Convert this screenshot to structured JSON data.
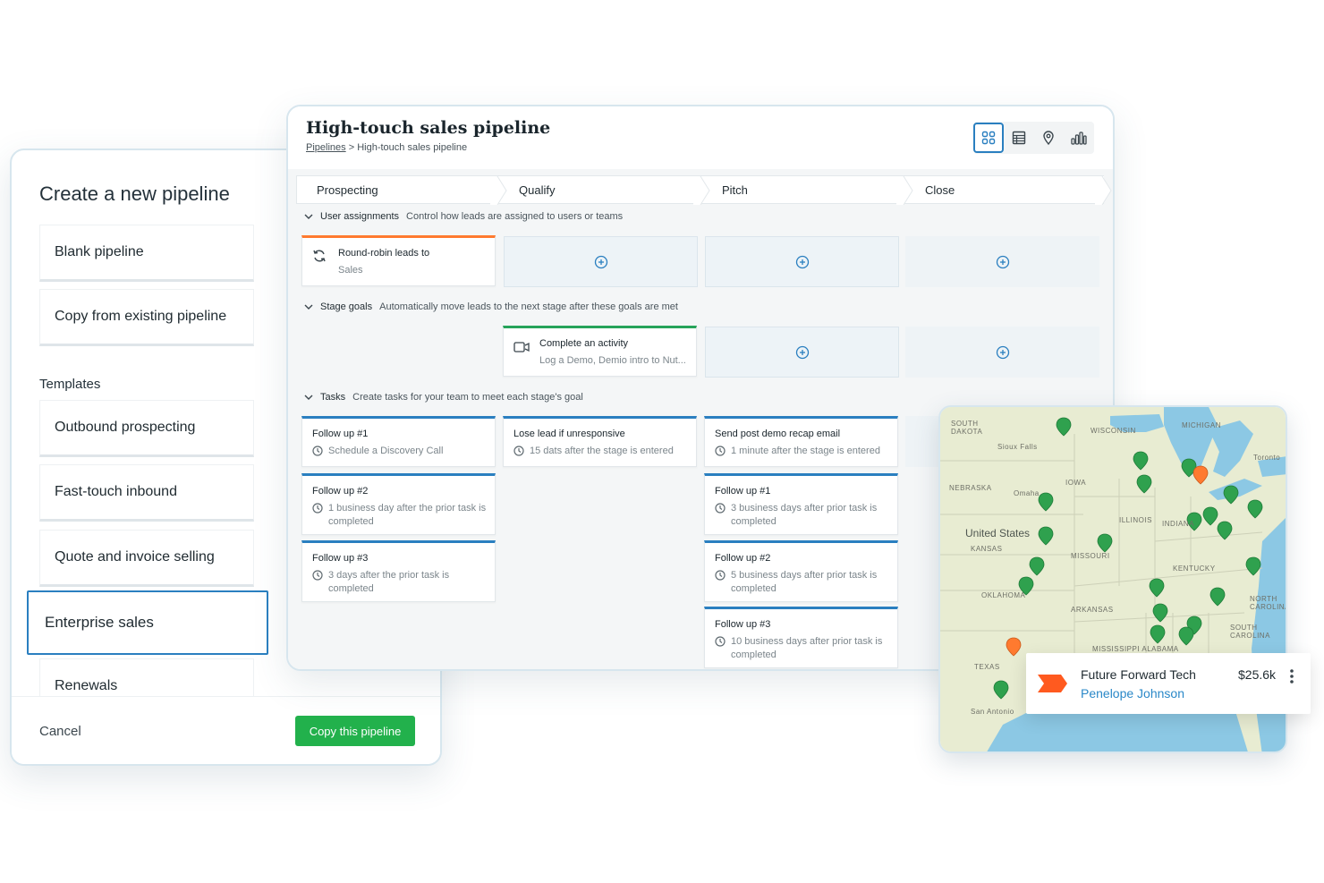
{
  "create_panel": {
    "title": "Create a new pipeline",
    "blank": "Blank pipeline",
    "copy_existing": "Copy from existing pipeline",
    "templates_label": "Templates",
    "templates": [
      "Outbound prospecting",
      "Fast-touch inbound",
      "Quote and invoice selling",
      "Enterprise sales",
      "Renewals"
    ],
    "cancel": "Cancel",
    "copy_button": "Copy this pipeline"
  },
  "pipeline": {
    "title": "High-touch sales pipeline",
    "breadcrumb_link": "Pipelines",
    "breadcrumb_sep": ">",
    "breadcrumb_current": "High-touch sales pipeline",
    "views": [
      "grid-view-icon",
      "table-view-icon",
      "map-view-icon",
      "chart-view-icon"
    ],
    "stages": [
      "Prospecting",
      "Qualify",
      "Pitch",
      "Close"
    ],
    "sections": {
      "user_assignments": {
        "name": "User assignments",
        "desc": "Control how leads are assigned to users or teams"
      },
      "stage_goals": {
        "name": "Stage goals",
        "desc": "Automatically move leads to the next stage after these goals are met"
      },
      "tasks": {
        "name": "Tasks",
        "desc": "Create tasks for your team to meet each stage's goal"
      }
    },
    "assignment_card": {
      "title": "Round-robin leads to",
      "sub": "Sales"
    },
    "goal_card": {
      "title": "Complete an activity",
      "sub": "Log a Demo, Demio intro to Nut..."
    },
    "tasks_prospecting": [
      {
        "title": "Follow up #1",
        "sub": "Schedule a Discovery Call"
      },
      {
        "title": "Follow up #2",
        "sub": "1 business day after the prior task is completed"
      },
      {
        "title": "Follow up #3",
        "sub": "3 days after the prior task is completed"
      }
    ],
    "tasks_qualify": [
      {
        "title": "Lose lead if unresponsive",
        "sub": "15 dats after the stage is entered"
      }
    ],
    "tasks_pitch": [
      {
        "title": "Send post demo recap email",
        "sub": "1 minute after the stage is entered"
      },
      {
        "title": "Follow up #1",
        "sub": "3 business days after prior task is completed"
      },
      {
        "title": "Follow up #2",
        "sub": "5 business days after prior task is completed"
      },
      {
        "title": "Follow up #3",
        "sub": "10 business days after prior task is completed"
      }
    ]
  },
  "map": {
    "labels": {
      "south_dakota": "SOUTH DAKOTA",
      "wisconsin": "WISCONSIN",
      "michigan": "MICHIGAN",
      "nebraska": "NEBRASKA",
      "iowa": "IOWA",
      "united_states": "United States",
      "kansas": "KANSAS",
      "illinois": "ILLINOIS",
      "indiana": "INDIANA",
      "missouri": "MISSOURI",
      "kentucky": "KENTUCKY",
      "oklahoma": "OKLAHOMA",
      "arkansas": "ARKANSAS",
      "north_carolina": "NORTH CAROLINA",
      "south_carolina": "SOUTH CAROLINA",
      "texas": "TEXAS",
      "san_antonio": "San Antonio",
      "mississippi_alabama": "MISSISSIPPI ALABAMA",
      "toronto": "Toronto",
      "sioux_falls": "Sioux Falls",
      "omaha": "Omaha"
    },
    "colors": {
      "land": "#e8ecd2",
      "water": "#8cc8e4",
      "pin": "#2fa14e",
      "pin_alt": "#ff7a2f"
    }
  },
  "deal_card": {
    "name": "Future Forward Tech",
    "owner": "Penelope Johnson",
    "amount": "$25.6k"
  }
}
